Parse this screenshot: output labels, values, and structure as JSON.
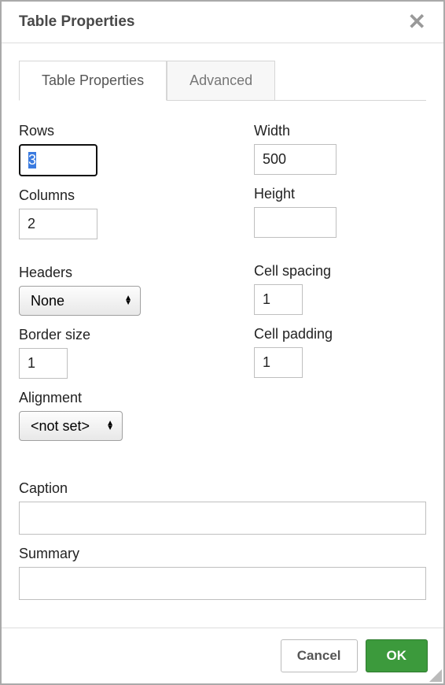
{
  "dialog": {
    "title": "Table Properties"
  },
  "tabs": {
    "properties": "Table Properties",
    "advanced": "Advanced"
  },
  "labels": {
    "rows": "Rows",
    "columns": "Columns",
    "headers": "Headers",
    "border_size": "Border size",
    "alignment": "Alignment",
    "width": "Width",
    "height": "Height",
    "cell_spacing": "Cell spacing",
    "cell_padding": "Cell padding",
    "caption": "Caption",
    "summary": "Summary"
  },
  "values": {
    "rows": "3",
    "columns": "2",
    "headers": "None",
    "border_size": "1",
    "alignment": "<not set>",
    "width": "500",
    "height": "",
    "cell_spacing": "1",
    "cell_padding": "1",
    "caption": "",
    "summary": ""
  },
  "buttons": {
    "cancel": "Cancel",
    "ok": "OK"
  }
}
